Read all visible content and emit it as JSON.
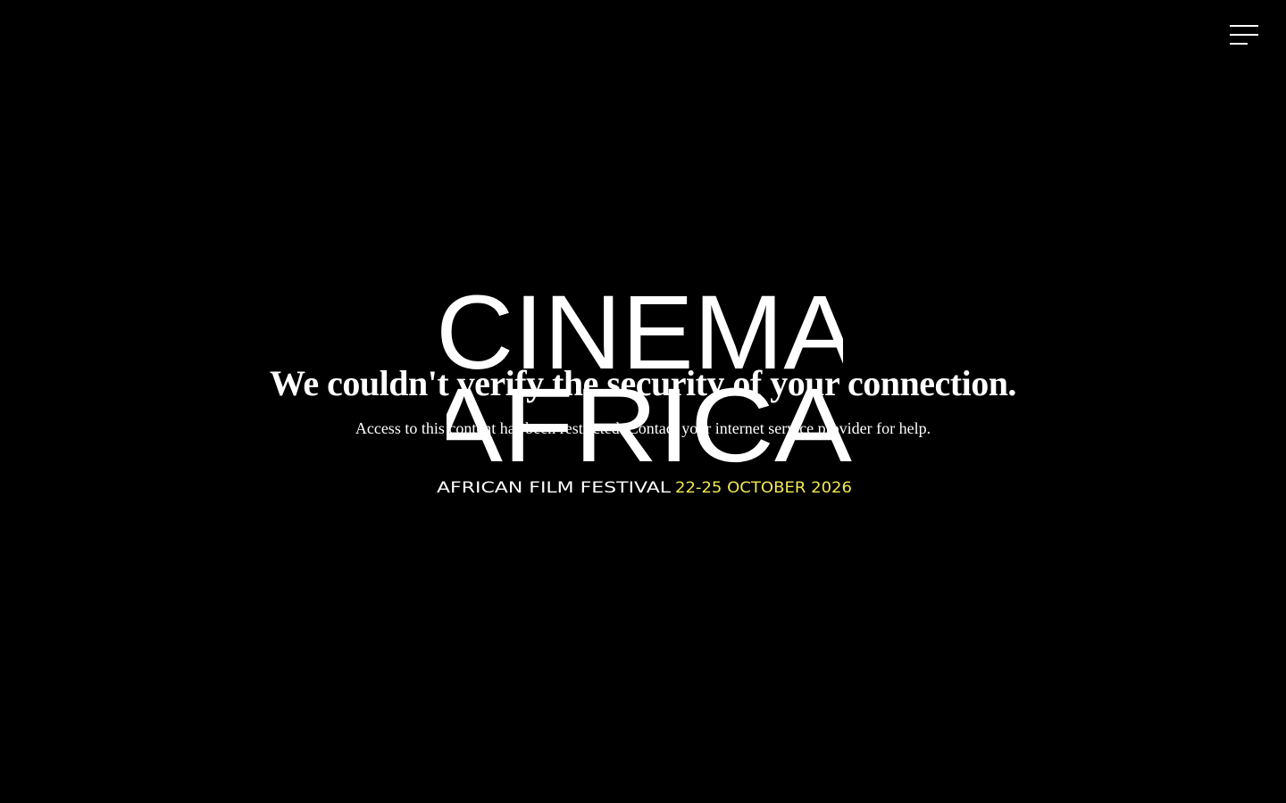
{
  "menu": {
    "icon": "hamburger-menu-icon"
  },
  "logo": {
    "line1": "CINEMA",
    "line2": "AFRICA",
    "tagline": "AFRICAN FILM FESTIVAL",
    "dates": "22-25 OCTOBER 2026",
    "accent_color": "#f2e94e"
  },
  "error": {
    "title": "We couldn't verify the security of your connection.",
    "message": "Access to this content has been restricted. Contact your internet service provider for help."
  }
}
